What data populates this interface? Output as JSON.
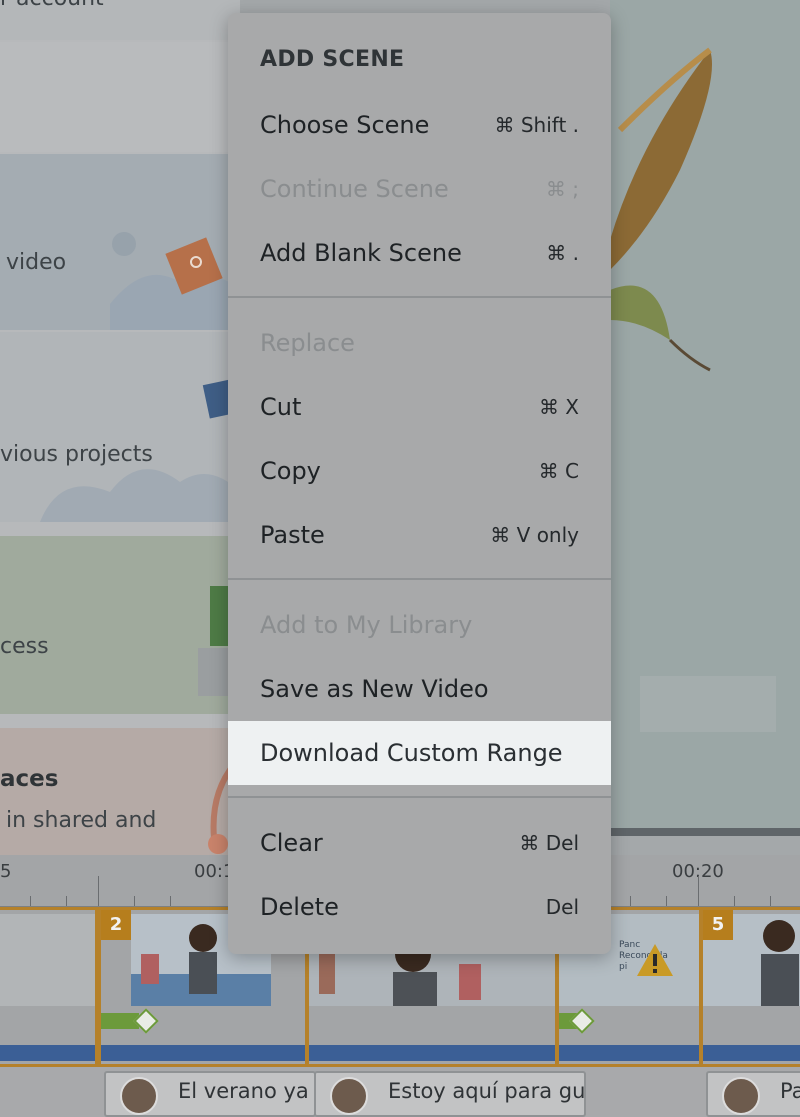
{
  "background": {
    "left_cards": [
      {
        "title": "",
        "text": "r account"
      },
      {
        "title": "",
        "text": ""
      },
      {
        "title": "",
        "text": "video"
      },
      {
        "title": "",
        "text": "vious projects"
      },
      {
        "title": "",
        "text": "cess"
      },
      {
        "title": "aces",
        "text": "in shared and"
      }
    ],
    "ruler": {
      "labels": [
        "5",
        "00:1",
        "00:20"
      ]
    },
    "clips": [
      {
        "badge": ""
      },
      {
        "badge": "2"
      },
      {
        "badge": ""
      },
      {
        "badge": ""
      },
      {
        "badge": "5"
      }
    ],
    "scene_sign_text": "Panc Reconoc la pi",
    "captions": [
      {
        "text": "El verano ya e"
      },
      {
        "text": "Estoy aquí para gui"
      },
      {
        "text": "Pa"
      }
    ]
  },
  "menu": {
    "header": "ADD SCENE",
    "items": [
      {
        "label": "Choose Scene",
        "shortcut": "⌘ Shift .",
        "disabled": false
      },
      {
        "label": "Continue Scene",
        "shortcut": "⌘ ;",
        "disabled": true
      },
      {
        "label": "Add Blank Scene",
        "shortcut": "⌘ .",
        "disabled": false
      },
      {
        "label": "Replace",
        "shortcut": "",
        "disabled": true
      },
      {
        "label": "Cut",
        "shortcut": "⌘ X",
        "disabled": false
      },
      {
        "label": "Copy",
        "shortcut": "⌘ C",
        "disabled": false
      },
      {
        "label": "Paste",
        "shortcut": "⌘ V only",
        "disabled": false
      },
      {
        "label": "Add to My Library",
        "shortcut": "",
        "disabled": true
      },
      {
        "label": "Save as New Video",
        "shortcut": "",
        "disabled": false
      },
      {
        "label": "Download Custom Range",
        "shortcut": "",
        "disabled": false,
        "highlighted": true
      },
      {
        "label": "Clear",
        "shortcut": "⌘ Del",
        "disabled": false
      },
      {
        "label": "Delete",
        "shortcut": "Del",
        "disabled": false
      }
    ]
  },
  "colors": {
    "overlay_dim": "#a8a9aa",
    "highlight": "#eef1f2",
    "clip_border": "#b5812a",
    "track_blue": "#3b5f96",
    "track_green": "#6c9a3b"
  }
}
